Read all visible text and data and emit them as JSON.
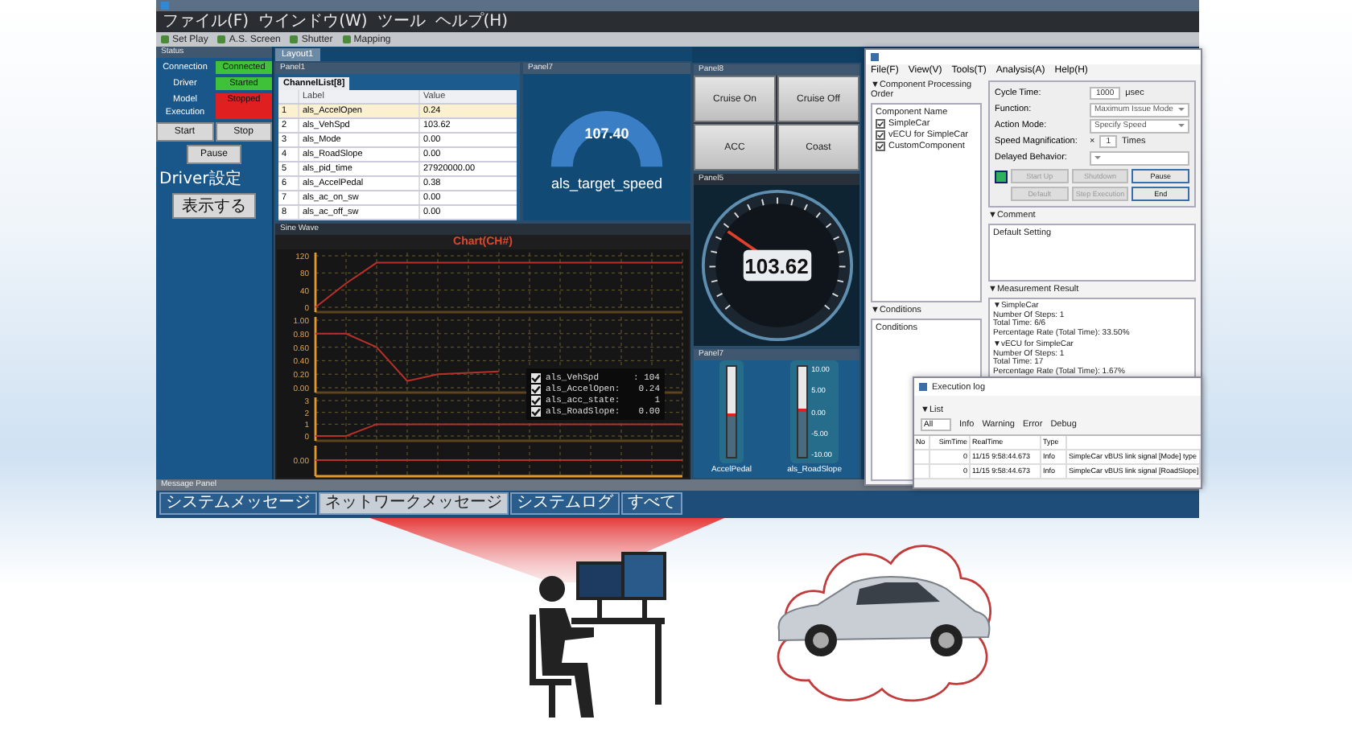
{
  "app": {
    "menu": [
      "ファイル(F)",
      "ウインドウ(W)",
      "ツール",
      "ヘルプ(H)"
    ],
    "toolbar": [
      "Set Play",
      "A.S. Screen",
      "Shutter",
      "Mapping"
    ],
    "layout_tab": "Layout1"
  },
  "status_panel": {
    "title": "Status",
    "rows": [
      {
        "label": "Connection",
        "value": "Connected",
        "color": "#3fc23a"
      },
      {
        "label": "Driver",
        "value": "Started",
        "color": "#3fc23a"
      },
      {
        "label": "Model Execution",
        "value": "Stopped",
        "color": "#e02020"
      }
    ],
    "buttons": [
      "Start",
      "Stop"
    ],
    "pause_button": "Pause",
    "driver_label": "Driver設定",
    "show_button": "表示する"
  },
  "channel_panel": {
    "title": "Panel1",
    "tab": "ChannelList[8]",
    "columns": [
      "Label",
      "Value"
    ],
    "rows": [
      {
        "no": "1",
        "label": "als_AccelOpen",
        "value": "0.24",
        "selected": true
      },
      {
        "no": "2",
        "label": "als_VehSpd",
        "value": "103.62",
        "selected": false
      },
      {
        "no": "3",
        "label": "als_Mode",
        "value": "0.00",
        "selected": false
      },
      {
        "no": "4",
        "label": "als_RoadSlope",
        "value": "0.00",
        "selected": false
      },
      {
        "no": "5",
        "label": "als_pid_time",
        "value": "27920000.00",
        "selected": false
      },
      {
        "no": "6",
        "label": "als_AccelPedal",
        "value": "0.38",
        "selected": false
      },
      {
        "no": "7",
        "label": "als_ac_on_sw",
        "value": "0.00",
        "selected": false
      },
      {
        "no": "8",
        "label": "als_ac_off_sw",
        "value": "0.00",
        "selected": false
      }
    ]
  },
  "target_gauge": {
    "title": "Panel7",
    "value": "107.40",
    "label": "als_target_speed"
  },
  "chart_panel": {
    "title": "Sine Wave",
    "plots": [
      {
        "chart_data": {
          "type": "line",
          "title": "Chart(CH#)",
          "categories": [
            null,
            null,
            null,
            null,
            null,
            null,
            null,
            null,
            null,
            null,
            null,
            null,
            null
          ],
          "ylim": [
            0,
            120
          ],
          "yticks": [
            0,
            40,
            80,
            120
          ],
          "grid": true,
          "series": [
            {
              "color": "#b8302a",
              "values": [
                0,
                56,
                104,
                104,
                104,
                104,
                104,
                104,
                104,
                104,
                104,
                104,
                104
              ]
            }
          ]
        }
      },
      {
        "chart_data": {
          "type": "line",
          "categories": [
            null,
            null,
            null,
            null,
            null,
            null,
            null,
            null,
            null,
            null,
            null,
            null,
            null
          ],
          "ylim": [
            0,
            1
          ],
          "yticks": [
            {
              "value": 0,
              "label": "0.00"
            },
            {
              "value": 0.2,
              "label": "0.20"
            },
            {
              "value": 0.4,
              "label": "0.40"
            },
            {
              "value": 0.6,
              "label": "0.60"
            },
            {
              "value": 0.8,
              "label": "0.80"
            },
            {
              "value": 1,
              "label": "1.00"
            }
          ],
          "grid": true,
          "series": [
            {
              "color": "#b8302a",
              "values": [
                0.8,
                0.8,
                0.6,
                0.1,
                0.2,
                0.22,
                0.24,
                null,
                null,
                null,
                null,
                null,
                null
              ]
            }
          ]
        }
      },
      {
        "chart_data": {
          "type": "line",
          "categories": [
            null,
            null,
            null,
            null,
            null,
            null,
            null,
            null,
            null,
            null,
            null,
            null,
            null
          ],
          "ylim": [
            0,
            3
          ],
          "yticks": [
            0,
            1,
            2,
            3
          ],
          "grid": true,
          "series": [
            {
              "color": "#b8302a",
              "values": [
                0,
                0,
                1,
                1,
                1,
                1,
                1,
                1,
                1,
                1,
                1,
                1,
                1
              ]
            }
          ]
        }
      },
      {
        "axis_label": "0.00"
      }
    ],
    "legend": [
      {
        "name": "als_VehSpd",
        "reading": ": 104",
        "checked": true
      },
      {
        "name": "als_AccelOpen:",
        "reading": "0.24",
        "checked": true
      },
      {
        "name": "als_acc_state:",
        "reading": "1",
        "checked": true
      },
      {
        "name": "als_RoadSlope:",
        "reading": "0.00",
        "checked": true
      }
    ]
  },
  "button_panel": {
    "title": "Panel8",
    "buttons": [
      "Cruise On",
      "Cruise Off",
      "ACC",
      "Coast"
    ]
  },
  "speed_gauge": {
    "title": "Panel5",
    "value": "103.62"
  },
  "slider_panel": {
    "title": "Panel7",
    "sliders": [
      {
        "name": "AccelPedal",
        "level": 0.45
      },
      {
        "name": "als_RoadSlope",
        "level": 0.5,
        "ticks": [
          "10.00",
          "5.00",
          "0.00",
          "-5.00",
          "-10.00"
        ]
      }
    ]
  },
  "message_panel": {
    "title": "Message Panel",
    "tabs": [
      {
        "label": "システムメッセージ",
        "selected": false
      },
      {
        "label": "ネットワークメッセージ",
        "selected": true
      },
      {
        "label": "システムログ",
        "selected": false
      },
      {
        "label": "すべて",
        "selected": false
      }
    ]
  },
  "dsil_window": {
    "menu": [
      "File(F)",
      "View(V)",
      "Tools(T)",
      "Analysis(A)",
      "Help(H)"
    ],
    "order_title": "▼Component Processing Order",
    "component_header": "Component Name",
    "components": [
      {
        "name": "SimpleCar",
        "checked": true
      },
      {
        "name": "vECU for SimpleCar",
        "checked": true
      },
      {
        "name": "CustomComponent",
        "checked": true
      }
    ],
    "settings": [
      {
        "label": "Cycle Time:",
        "value": "1000",
        "unit": "μsec",
        "kind": "text"
      },
      {
        "label": "Function:",
        "value": "Maximum Issue Mode",
        "kind": "select"
      },
      {
        "label": "Action Mode:",
        "value": "Specify Speed",
        "kind": "select"
      },
      {
        "label": "Speed Magnification:",
        "value": "1",
        "prefix": "×",
        "unit": "Times",
        "kind": "text"
      },
      {
        "label": "Delayed Behavior:",
        "kind": "select"
      }
    ],
    "controls": [
      {
        "label": "Start Up",
        "disabled": true
      },
      {
        "label": "Shutdown",
        "disabled": true
      },
      {
        "label": "Pause",
        "disabled": false
      },
      {
        "label": "Default",
        "disabled": true
      },
      {
        "label": "Step Execution",
        "disabled": true
      },
      {
        "label": "End",
        "disabled": false
      }
    ],
    "comment_title": "▼Comment",
    "comment": "Default Setting",
    "conditions_title": "▼Conditions",
    "conditions": "Conditions",
    "result_title": "▼Measurement Result",
    "results": [
      {
        "name": "▼SimpleCar",
        "lines": [
          "Number Of Steps: 1",
          "Total Time: 6/6",
          "Percentage Rate (Total Time): 33.50%"
        ]
      },
      {
        "name": "▼vECU for SimpleCar",
        "lines": [
          "Number Of Steps: 1",
          "Total Time: 17",
          "Percentage Rate (Total Time): 1.67%"
        ]
      }
    ]
  },
  "log_window": {
    "title": "Execution log",
    "list_title": "▼List",
    "filter": "All",
    "levels": [
      "Info",
      "Warning",
      "Error",
      "Debug"
    ],
    "columns": [
      "No",
      "SimTime",
      "RealTime",
      "Type"
    ],
    "rows": [
      [
        "",
        "0",
        "11/15 9:58:44.673",
        "Info",
        "SimpleCar vBUS link signal [Mode] type"
      ],
      [
        "",
        "0",
        "11/15 9:58:44.673",
        "Info",
        "SimpleCar vBUS link signal [RoadSlope]"
      ]
    ]
  }
}
